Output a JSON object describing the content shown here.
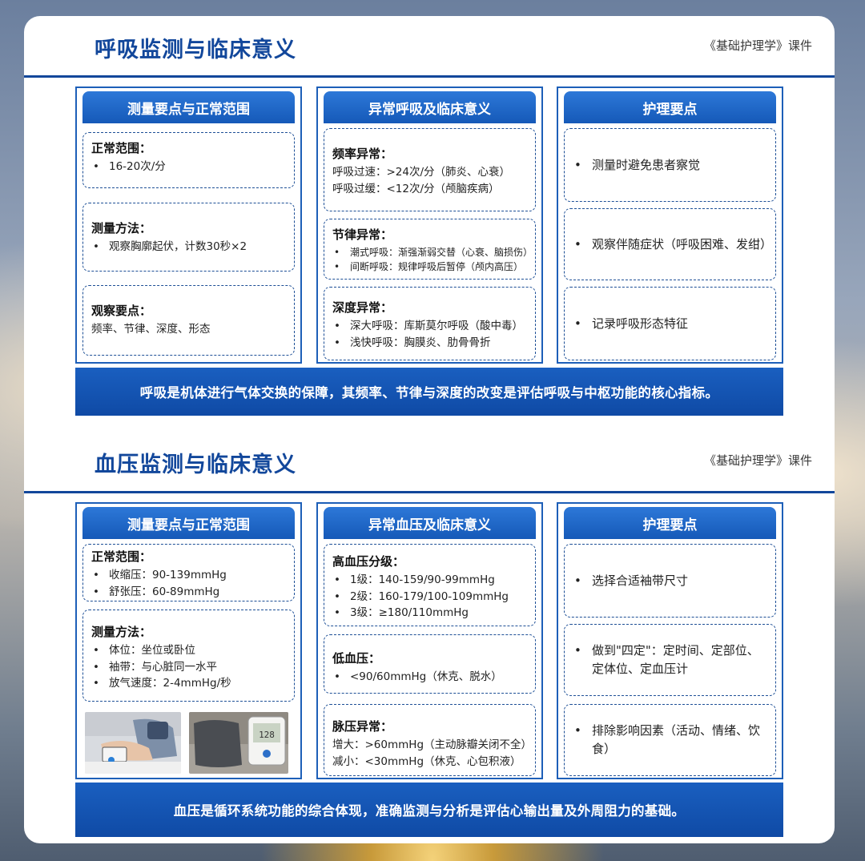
{
  "sections": [
    {
      "title": "呼吸监测与临床意义",
      "source": "《基础护理学》课件",
      "col1": {
        "header": "测量要点与正常范围",
        "box1": {
          "title": "正常范围：",
          "l1_bul": "•",
          "l1": "16-20次/分"
        },
        "box2": {
          "title": "测量方法：",
          "l1_bul": "•",
          "l1": "观察胸廓起伏，计数30秒×2"
        },
        "box3": {
          "title": "观察要点：",
          "l1": "频率、节律、深度、形态"
        }
      },
      "col2": {
        "header": "异常呼吸及临床意义",
        "box1": {
          "title": "频率异常：",
          "l1": "呼吸过速：>24次/分（肺炎、心衰）",
          "l2": "呼吸过缓：<12次/分（颅脑疾病）"
        },
        "box2": {
          "title": "节律异常：",
          "l1_bul": "•",
          "l1": "潮式呼吸：渐强渐弱交替（心衰、脑损伤）",
          "l2_bul": "•",
          "l2": "间断呼吸：规律呼吸后暂停（颅内高压）"
        },
        "box3": {
          "title": "深度异常：",
          "l1_bul": "•",
          "l1": "深大呼吸：库斯莫尔呼吸（酸中毒）",
          "l2_bul": "•",
          "l2": "浅快呼吸：胸膜炎、肋骨骨折"
        }
      },
      "col3": {
        "header": "护理要点",
        "bul": "•",
        "items": [
          "测量时避免患者察觉",
          "观察伴随症状（呼吸困难、发绀）",
          "记录呼吸形态特征"
        ]
      },
      "banner": "呼吸是机体进行气体交换的保障，其频率、节律与深度的改变是评估呼吸与中枢功能的核心指标。"
    },
    {
      "title": "血压监测与临床意义",
      "source": "《基础护理学》课件",
      "col1": {
        "header": "测量要点与正常范围",
        "box1": {
          "title": "正常范围：",
          "l1_bul": "•",
          "l1": "收缩压：90-139mmHg",
          "l2_bul": "•",
          "l2": "舒张压：60-89mmHg"
        },
        "box2": {
          "title": "测量方法：",
          "l1_bul": "•",
          "l1": "体位：坐位或卧位",
          "l2_bul": "•",
          "l2": "袖带：与心脏同一水平",
          "l3_bul": "•",
          "l3": "放气速度：2-4mmHg/秒"
        }
      },
      "col2": {
        "header": "异常血压及临床意义",
        "box1": {
          "title": "高血压分级：",
          "l1_bul": "•",
          "l1": "1级：140-159/90-99mmHg",
          "l2_bul": "•",
          "l2": "2级：160-179/100-109mmHg",
          "l3_bul": "•",
          "l3": "3级：≥180/110mmHg"
        },
        "box2": {
          "title": "低血压：",
          "l1_bul": "•",
          "l1": "<90/60mmHg（休克、脱水）"
        },
        "box3": {
          "title": "脉压异常：",
          "l1": "增大：>60mmHg（主动脉瓣关闭不全）",
          "l2": "减小：<30mmHg（休克、心包积液）"
        }
      },
      "col3": {
        "header": "护理要点",
        "bul": "•",
        "items": [
          "选择合适袖带尺寸",
          "做到\"四定\"：定时间、定部位、定体位、定血压计",
          "排除影响因素（活动、情绪、饮食）"
        ]
      },
      "banner": "血压是循环系统功能的综合体现，准确监测与分析是评估心输出量及外周阻力的基础。"
    }
  ],
  "colors": {
    "primary": "#12479b",
    "header": "#1559b8",
    "banner": "#0f4aa5"
  }
}
